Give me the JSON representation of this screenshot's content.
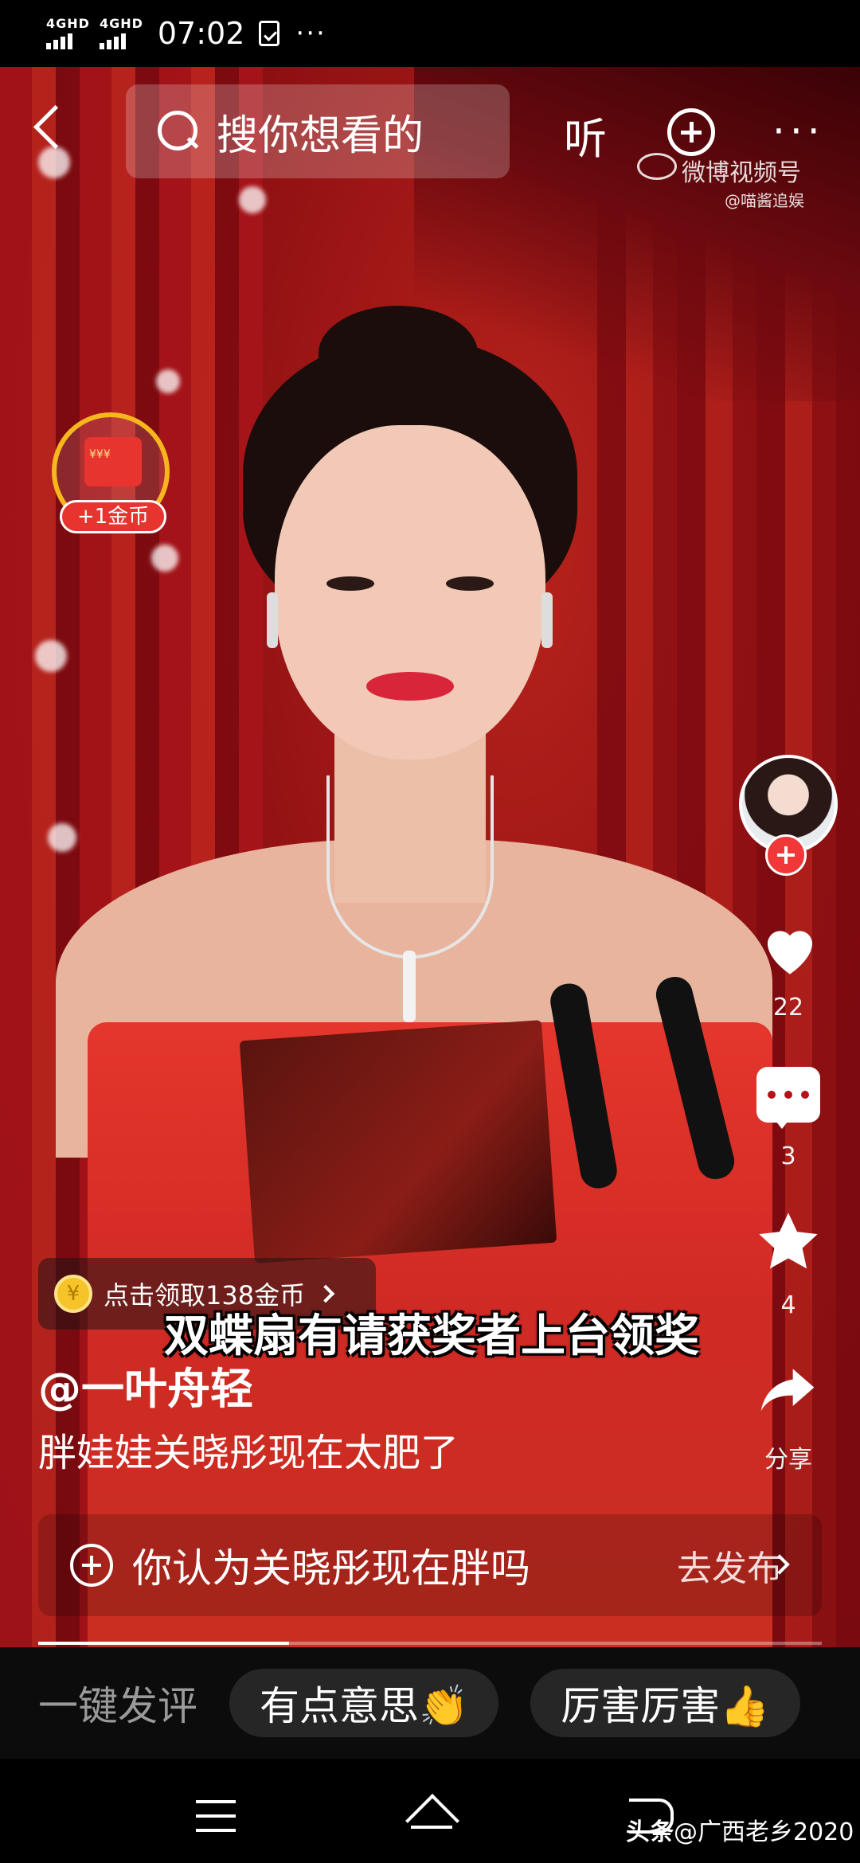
{
  "status_bar": {
    "net1": "4GHD",
    "net2": "4GHD",
    "time": "07:02",
    "more": "···"
  },
  "top_bar": {
    "search_placeholder": "搜你想看的",
    "listen_label": "听",
    "more_label": "···"
  },
  "watermark": {
    "brand": "微博视频号",
    "handle": "@喵酱追娱"
  },
  "reward": {
    "coins_glyph": "¥¥¥",
    "label": "+1金币"
  },
  "rail": {
    "likes": "22",
    "comments": "3",
    "favorites": "4",
    "share_label": "分享"
  },
  "coin_offer": {
    "coin_glyph": "¥",
    "text": "点击领取138金币"
  },
  "video": {
    "caption": "双蝶扇有请获奖者上台领奖",
    "author": "@一叶舟轻",
    "description": "胖娃娃关晓彤现在太肥了",
    "progress": 0.32
  },
  "prompt": {
    "question": "你认为关晓彤现在胖吗",
    "action": "去发布"
  },
  "quick_comment": {
    "label": "一键发评",
    "chips": [
      "有点意思👏",
      "厉害厉害👍"
    ]
  },
  "credit": {
    "brand": "头条",
    "handle": "@广西老乡2020"
  },
  "colors": {
    "accent_red": "#e7342e",
    "gold": "#f6b71e",
    "follow_red": "#f03838"
  }
}
